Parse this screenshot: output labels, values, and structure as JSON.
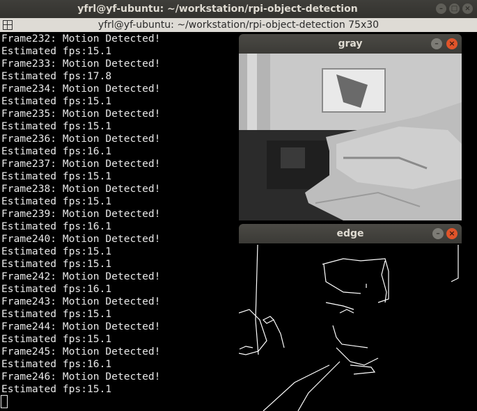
{
  "outer_window": {
    "title": "yfrl@yf-ubuntu: ~/workstation/rpi-object-detection"
  },
  "terminal": {
    "title": "yfrl@yf-ubuntu: ~/workstation/rpi-object-detection 75x30",
    "lines": [
      "Frame232: Motion Detected!",
      "Estimated fps:15.1",
      "Frame233: Motion Detected!",
      "Estimated fps:17.8",
      "Frame234: Motion Detected!",
      "Estimated fps:15.1",
      "Frame235: Motion Detected!",
      "Estimated fps:15.1",
      "Frame236: Motion Detected!",
      "Estimated fps:16.1",
      "Frame237: Motion Detected!",
      "Estimated fps:15.1",
      "Frame238: Motion Detected!",
      "Estimated fps:15.1",
      "Frame239: Motion Detected!",
      "Estimated fps:16.1",
      "Frame240: Motion Detected!",
      "Estimated fps:15.1",
      "Estimated fps:15.1",
      "Frame242: Motion Detected!",
      "Estimated fps:16.1",
      "Frame243: Motion Detected!",
      "Estimated fps:15.1",
      "Frame244: Motion Detected!",
      "Estimated fps:15.1",
      "Frame245: Motion Detected!",
      "Estimated fps:16.1",
      "Frame246: Motion Detected!",
      "Estimated fps:15.1"
    ]
  },
  "windows": {
    "gray": {
      "title": "gray"
    },
    "edge": {
      "title": "edge"
    }
  },
  "buttons": {
    "minimize": "–",
    "maximize": "□",
    "close": "×"
  },
  "colors": {
    "close_accent": "#e0542a",
    "titlebar": "#3b3a36"
  }
}
